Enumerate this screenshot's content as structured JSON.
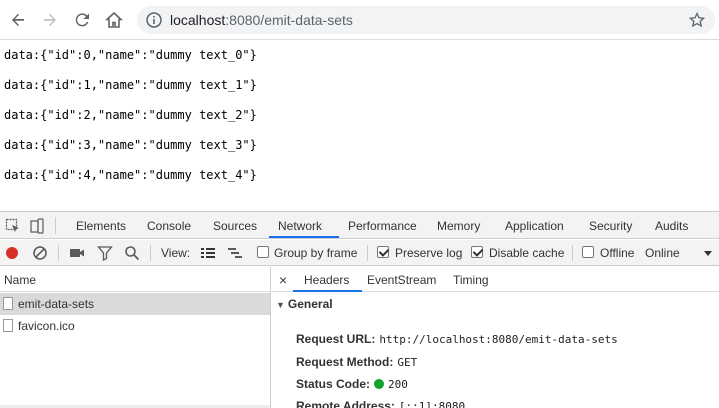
{
  "browser": {
    "url_host": "localhost",
    "url_rest": ":8080/emit-data-sets"
  },
  "page": {
    "lines": [
      "data:{\"id\":0,\"name\":\"dummy text_0\"}",
      "data:{\"id\":1,\"name\":\"dummy text_1\"}",
      "data:{\"id\":2,\"name\":\"dummy text_2\"}",
      "data:{\"id\":3,\"name\":\"dummy text_3\"}",
      "data:{\"id\":4,\"name\":\"dummy text_4\"}"
    ]
  },
  "devtools": {
    "tabs": [
      "Elements",
      "Console",
      "Sources",
      "Network",
      "Performance",
      "Memory",
      "Application",
      "Security",
      "Audits"
    ],
    "active_tab": "Network",
    "network_toolbar": {
      "view_label": "View:",
      "group_by_frame": "Group by frame",
      "preserve_log": "Preserve log",
      "disable_cache": "Disable cache",
      "offline": "Offline",
      "throttle": "Online"
    },
    "requests": {
      "header": "Name",
      "items": [
        "emit-data-sets",
        "favicon.ico"
      ]
    },
    "detail": {
      "tabs": [
        "Headers",
        "EventStream",
        "Timing"
      ],
      "section": "General",
      "fields": [
        {
          "key": "Request URL:",
          "value": "http://localhost:8080/emit-data-sets"
        },
        {
          "key": "Request Method:",
          "value": "GET"
        },
        {
          "key": "Status Code:",
          "value": "200"
        },
        {
          "key": "Remote Address:",
          "value": "[::1]:8080"
        }
      ]
    }
  },
  "colors": {
    "accent": "#1a73e8",
    "record": "#d93025",
    "status_ok": "#0ea52b"
  }
}
